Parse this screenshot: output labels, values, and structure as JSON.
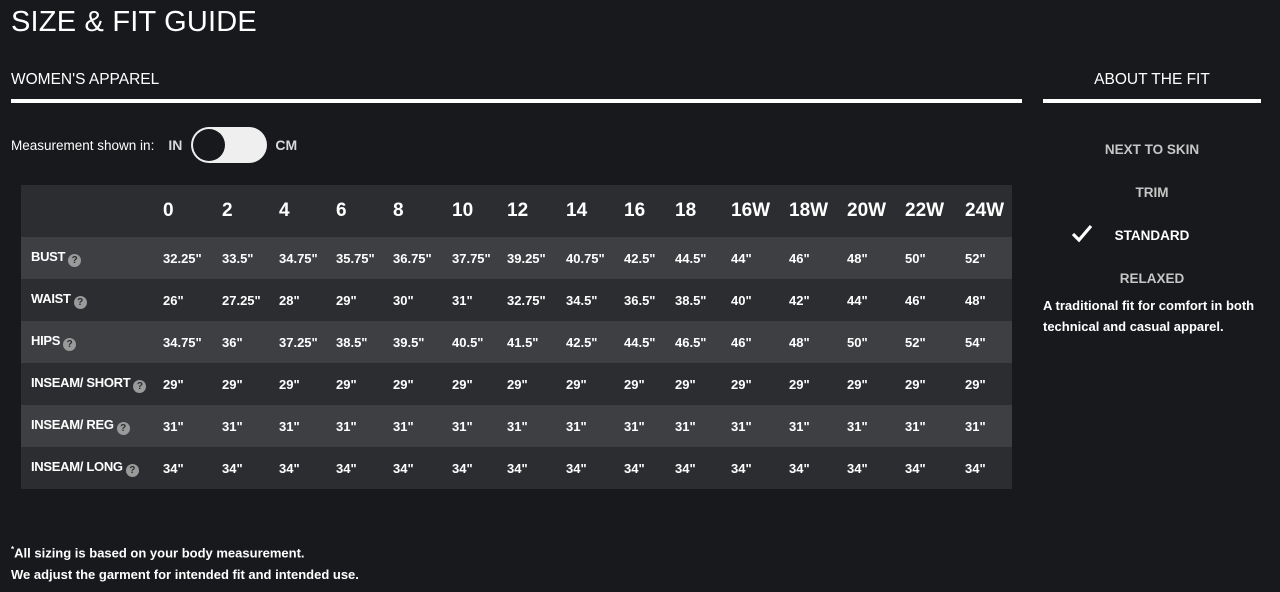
{
  "page_title": "SIZE & FIT GUIDE",
  "section_title": "WOMEN'S APPAREL",
  "side_title": "ABOUT THE FIT",
  "measurement": {
    "label": "Measurement shown in:",
    "unit_left": "IN",
    "unit_right": "CM",
    "selected": "IN"
  },
  "help_icon": "?",
  "table": {
    "columns": [
      "0",
      "2",
      "4",
      "6",
      "8",
      "10",
      "12",
      "14",
      "16",
      "18",
      "16W",
      "18W",
      "20W",
      "22W",
      "24W"
    ],
    "rows": [
      {
        "label": "BUST",
        "values": [
          "32.25\"",
          "33.5\"",
          "34.75\"",
          "35.75\"",
          "36.75\"",
          "37.75\"",
          "39.25\"",
          "40.75\"",
          "42.5\"",
          "44.5\"",
          "44\"",
          "46\"",
          "48\"",
          "50\"",
          "52\""
        ]
      },
      {
        "label": "WAIST",
        "values": [
          "26\"",
          "27.25\"",
          "28\"",
          "29\"",
          "30\"",
          "31\"",
          "32.75\"",
          "34.5\"",
          "36.5\"",
          "38.5\"",
          "40\"",
          "42\"",
          "44\"",
          "46\"",
          "48\""
        ]
      },
      {
        "label": "HIPS",
        "values": [
          "34.75\"",
          "36\"",
          "37.25\"",
          "38.5\"",
          "39.5\"",
          "40.5\"",
          "41.5\"",
          "42.5\"",
          "44.5\"",
          "46.5\"",
          "46\"",
          "48\"",
          "50\"",
          "52\"",
          "54\""
        ]
      },
      {
        "label": "INSEAM/ SHORT",
        "values": [
          "29\"",
          "29\"",
          "29\"",
          "29\"",
          "29\"",
          "29\"",
          "29\"",
          "29\"",
          "29\"",
          "29\"",
          "29\"",
          "29\"",
          "29\"",
          "29\"",
          "29\""
        ]
      },
      {
        "label": "INSEAM/ REG",
        "values": [
          "31\"",
          "31\"",
          "31\"",
          "31\"",
          "31\"",
          "31\"",
          "31\"",
          "31\"",
          "31\"",
          "31\"",
          "31\"",
          "31\"",
          "31\"",
          "31\"",
          "31\""
        ]
      },
      {
        "label": "INSEAM/ LONG",
        "values": [
          "34\"",
          "34\"",
          "34\"",
          "34\"",
          "34\"",
          "34\"",
          "34\"",
          "34\"",
          "34\"",
          "34\"",
          "34\"",
          "34\"",
          "34\"",
          "34\"",
          "34\""
        ]
      }
    ]
  },
  "fit": {
    "options": [
      "NEXT TO SKIN",
      "TRIM",
      "STANDARD",
      "RELAXED"
    ],
    "selected": "STANDARD",
    "description": "A traditional fit for comfort in both technical and casual apparel."
  },
  "footnote": {
    "marker": "*",
    "line1": "All sizing is based on your body measurement.",
    "line2": "We adjust the garment for intended fit and intended use."
  },
  "colors": {
    "background": "#17191c",
    "row_light": "#3d3f43",
    "row_dark": "#2b2d31",
    "text": "#ffffff"
  }
}
